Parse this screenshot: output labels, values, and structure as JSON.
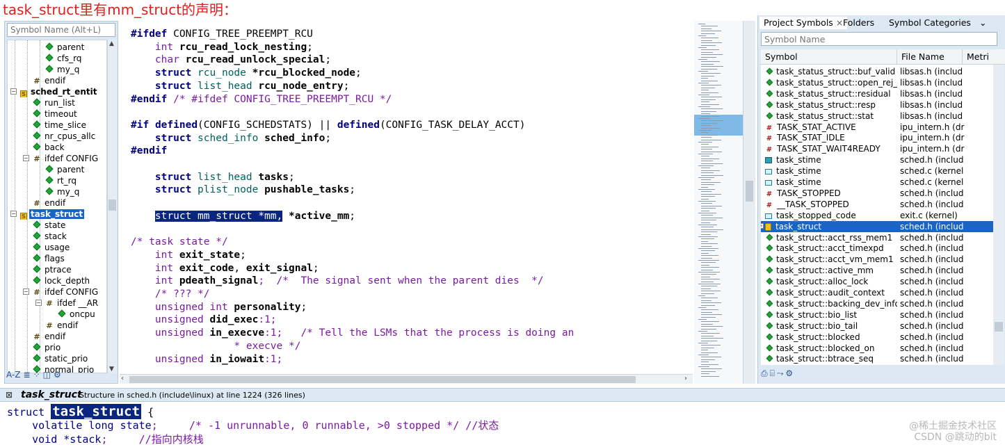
{
  "heading": "task_struct里有mm_struct的声明：",
  "left_panel": {
    "search_placeholder": "Symbol Name (Alt+L)",
    "tools": [
      "A-Z",
      "≣",
      "⁘",
      "◫",
      "⚙"
    ],
    "tree": [
      {
        "label": "parent",
        "icon": "member-icon",
        "indent": 3
      },
      {
        "label": "cfs_rq",
        "icon": "member-icon",
        "indent": 3
      },
      {
        "label": "my_q",
        "icon": "member-icon",
        "indent": 3
      },
      {
        "label": "endif",
        "icon": "preproc-icon",
        "indent": 2
      },
      {
        "label": "sched_rt_entit",
        "icon": "struct-icon",
        "indent": 1,
        "expander": "−",
        "bold": true
      },
      {
        "label": "run_list",
        "icon": "member-icon",
        "indent": 2
      },
      {
        "label": "timeout",
        "icon": "member-icon",
        "indent": 2
      },
      {
        "label": "time_slice",
        "icon": "member-icon",
        "indent": 2
      },
      {
        "label": "nr_cpus_allc",
        "icon": "member-icon",
        "indent": 2
      },
      {
        "label": "back",
        "icon": "member-icon",
        "indent": 2
      },
      {
        "label": "ifdef CONFIG",
        "icon": "preproc-icon",
        "indent": 2,
        "expander": "−"
      },
      {
        "label": "parent",
        "icon": "member-icon",
        "indent": 3
      },
      {
        "label": "rt_rq",
        "icon": "member-icon",
        "indent": 3
      },
      {
        "label": "my_q",
        "icon": "member-icon",
        "indent": 3
      },
      {
        "label": "endif",
        "icon": "preproc-icon",
        "indent": 2
      },
      {
        "label": "task_struct",
        "icon": "struct-icon",
        "indent": 1,
        "expander": "−",
        "bold": true,
        "selected": true
      },
      {
        "label": "state",
        "icon": "member-icon",
        "indent": 2
      },
      {
        "label": "stack",
        "icon": "member-icon",
        "indent": 2
      },
      {
        "label": "usage",
        "icon": "member-icon",
        "indent": 2
      },
      {
        "label": "flags",
        "icon": "member-icon",
        "indent": 2
      },
      {
        "label": "ptrace",
        "icon": "member-icon",
        "indent": 2
      },
      {
        "label": "lock_depth",
        "icon": "member-icon",
        "indent": 2
      },
      {
        "label": "ifdef CONFIG",
        "icon": "preproc-icon",
        "indent": 2,
        "expander": "−"
      },
      {
        "label": "ifdef __AR",
        "icon": "preproc-icon",
        "indent": 3,
        "expander": "−"
      },
      {
        "label": "oncpu",
        "icon": "member-icon",
        "indent": 4
      },
      {
        "label": "endif",
        "icon": "preproc-icon",
        "indent": 3
      },
      {
        "label": "endif",
        "icon": "preproc-icon",
        "indent": 2
      },
      {
        "label": "prio",
        "icon": "member-icon",
        "indent": 2
      },
      {
        "label": "static_prio",
        "icon": "member-icon",
        "indent": 2
      },
      {
        "label": "normal_prio",
        "icon": "member-icon",
        "indent": 2
      }
    ]
  },
  "editor": {
    "lines": [
      [
        {
          "t": "#ifdef",
          "c": "pp"
        },
        {
          "t": " CONFIG_TREE_PREEMPT_RCU",
          "c": ""
        }
      ],
      [
        {
          "t": "    int",
          "c": "kw"
        },
        {
          "t": " ",
          "c": ""
        },
        {
          "t": "rcu_read_lock_nesting",
          "c": "id"
        },
        {
          "t": ";",
          "c": ""
        }
      ],
      [
        {
          "t": "    char",
          "c": "kw"
        },
        {
          "t": " ",
          "c": ""
        },
        {
          "t": "rcu_read_unlock_special",
          "c": "id"
        },
        {
          "t": ";",
          "c": ""
        }
      ],
      [
        {
          "t": "    struct",
          "c": "pp"
        },
        {
          "t": " rcu_node ",
          "c": "ty"
        },
        {
          "t": "*rcu_blocked_node",
          "c": "id"
        },
        {
          "t": ";",
          "c": ""
        }
      ],
      [
        {
          "t": "    struct",
          "c": "pp"
        },
        {
          "t": " list_head ",
          "c": "ty"
        },
        {
          "t": "rcu_node_entry",
          "c": "id"
        },
        {
          "t": ";",
          "c": ""
        }
      ],
      [
        {
          "t": "#endif",
          "c": "pp"
        },
        {
          "t": " /* #ifdef CONFIG_TREE_PREEMPT_RCU */",
          "c": "cm"
        }
      ],
      [],
      [
        {
          "t": "#if",
          "c": "pp"
        },
        {
          "t": " ",
          "c": ""
        },
        {
          "t": "defined",
          "c": "pp"
        },
        {
          "t": "(CONFIG_SCHEDSTATS) || ",
          "c": ""
        },
        {
          "t": "defined",
          "c": "pp"
        },
        {
          "t": "(CONFIG_TASK_DELAY_ACCT)",
          "c": ""
        }
      ],
      [
        {
          "t": "    struct",
          "c": "pp"
        },
        {
          "t": " sched_info ",
          "c": "ty"
        },
        {
          "t": "sched_info",
          "c": "id"
        },
        {
          "t": ";",
          "c": ""
        }
      ],
      [
        {
          "t": "#endif",
          "c": "pp"
        }
      ],
      [],
      [
        {
          "t": "    struct",
          "c": "pp"
        },
        {
          "t": " list_head ",
          "c": "ty"
        },
        {
          "t": "tasks",
          "c": "id"
        },
        {
          "t": ";",
          "c": ""
        }
      ],
      [
        {
          "t": "    struct",
          "c": "pp"
        },
        {
          "t": " plist_node ",
          "c": "ty"
        },
        {
          "t": "pushable_tasks",
          "c": "id"
        },
        {
          "t": ";",
          "c": ""
        }
      ],
      [],
      [
        {
          "t": "    ",
          "c": ""
        },
        {
          "t": "struct mm_struct *mm,",
          "c": "hl"
        },
        {
          "t": " ",
          "c": ""
        },
        {
          "t": "*active_mm",
          "c": "id"
        },
        {
          "t": ";",
          "c": ""
        }
      ],
      [],
      [
        {
          "t": "/* task state */",
          "c": "cm"
        }
      ],
      [
        {
          "t": "    int",
          "c": "kw"
        },
        {
          "t": " ",
          "c": ""
        },
        {
          "t": "exit_state",
          "c": "id"
        },
        {
          "t": ";",
          "c": ""
        }
      ],
      [
        {
          "t": "    int",
          "c": "kw"
        },
        {
          "t": " ",
          "c": ""
        },
        {
          "t": "exit_code",
          "c": "id"
        },
        {
          "t": ", ",
          "c": ""
        },
        {
          "t": "exit_signal",
          "c": "id"
        },
        {
          "t": ";",
          "c": ""
        }
      ],
      [
        {
          "t": "    int",
          "c": "kw"
        },
        {
          "t": " ",
          "c": ""
        },
        {
          "t": "pdeath_signal",
          "c": "id"
        },
        {
          "t": ";  /*  The signal sent when the parent dies  */",
          "c": "cm"
        }
      ],
      [
        {
          "t": "    /* ??? */",
          "c": "cm"
        }
      ],
      [
        {
          "t": "    unsigned int",
          "c": "kw"
        },
        {
          "t": " ",
          "c": ""
        },
        {
          "t": "personality",
          "c": "id"
        },
        {
          "t": ";",
          "c": ""
        }
      ],
      [
        {
          "t": "    unsigned",
          "c": "kw"
        },
        {
          "t": " ",
          "c": ""
        },
        {
          "t": "did_exec",
          "c": "id"
        },
        {
          "t": ":1;",
          "c": "cm"
        }
      ],
      [
        {
          "t": "    unsigned",
          "c": "kw"
        },
        {
          "t": " ",
          "c": ""
        },
        {
          "t": "in_execve",
          "c": "id"
        },
        {
          "t": ":1;   /* Tell the LSMs that the process is doing an",
          "c": "cm"
        }
      ],
      [
        {
          "t": "                 * execve */",
          "c": "cm"
        }
      ],
      [
        {
          "t": "    unsigned",
          "c": "kw"
        },
        {
          "t": " ",
          "c": ""
        },
        {
          "t": "in_iowait",
          "c": "id"
        },
        {
          "t": ":1;",
          "c": "cm"
        }
      ]
    ]
  },
  "symbols_panel": {
    "tabs": [
      "Project Symbols",
      "Folders",
      "Symbol Categories"
    ],
    "close_glyph": "×",
    "more_glyph": "⌄",
    "search_placeholder": "Symbol Name",
    "columns": [
      "Symbol",
      "File Name",
      "Metri"
    ],
    "rows": [
      {
        "symbol": "task_status_struct::buf_valid",
        "file": "libsas.h (includ",
        "icon": "member"
      },
      {
        "symbol": "task_status_struct::open_rej_",
        "file": "libsas.h (includ",
        "icon": "member"
      },
      {
        "symbol": "task_status_struct::residual",
        "file": "libsas.h (includ",
        "icon": "member"
      },
      {
        "symbol": "task_status_struct::resp",
        "file": "libsas.h (includ",
        "icon": "member"
      },
      {
        "symbol": "task_status_struct::stat",
        "file": "libsas.h (includ",
        "icon": "member"
      },
      {
        "symbol": "TASK_STAT_ACTIVE",
        "file": "ipu_intern.h (dr",
        "icon": "macro"
      },
      {
        "symbol": "TASK_STAT_IDLE",
        "file": "ipu_intern.h (dr",
        "icon": "macro"
      },
      {
        "symbol": "TASK_STAT_WAIT4READY",
        "file": "ipu_intern.h (dr",
        "icon": "macro"
      },
      {
        "symbol": "task_stime",
        "file": "sched.h (includ",
        "icon": "func"
      },
      {
        "symbol": "task_stime",
        "file": "sched.c (kernel",
        "icon": "var"
      },
      {
        "symbol": "task_stime",
        "file": "sched.c (kernel",
        "icon": "var"
      },
      {
        "symbol": "TASK_STOPPED",
        "file": "sched.h (includ",
        "icon": "macro"
      },
      {
        "symbol": "__TASK_STOPPED",
        "file": "sched.h (includ",
        "icon": "macro"
      },
      {
        "symbol": "task_stopped_code",
        "file": "exit.c (kernel)",
        "icon": "var"
      },
      {
        "symbol": "task_struct",
        "file": "sched.h (includ",
        "icon": "struct",
        "selected": true
      },
      {
        "symbol": "task_struct::acct_rss_mem1",
        "file": "sched.h (includ",
        "icon": "member"
      },
      {
        "symbol": "task_struct::acct_timexpd",
        "file": "sched.h (includ",
        "icon": "member"
      },
      {
        "symbol": "task_struct::acct_vm_mem1",
        "file": "sched.h (includ",
        "icon": "member"
      },
      {
        "symbol": "task_struct::active_mm",
        "file": "sched.h (includ",
        "icon": "member"
      },
      {
        "symbol": "task_struct::alloc_lock",
        "file": "sched.h (includ",
        "icon": "member"
      },
      {
        "symbol": "task_struct::audit_context",
        "file": "sched.h (includ",
        "icon": "member"
      },
      {
        "symbol": "task_struct::backing_dev_info",
        "file": "sched.h (includ",
        "icon": "member"
      },
      {
        "symbol": "task_struct::bio_list",
        "file": "sched.h (includ",
        "icon": "member"
      },
      {
        "symbol": "task_struct::bio_tail",
        "file": "sched.h (includ",
        "icon": "member"
      },
      {
        "symbol": "task_struct::blocked",
        "file": "sched.h (includ",
        "icon": "member"
      },
      {
        "symbol": "task_struct::blocked_on",
        "file": "sched.h (includ",
        "icon": "member"
      },
      {
        "symbol": "task_struct::btrace_seq",
        "file": "sched.h (includ",
        "icon": "member"
      }
    ],
    "tools": [
      "⎙",
      "⌸",
      "⤳",
      "⚙"
    ]
  },
  "context": {
    "icon": "⊠",
    "symbol": "task_struct",
    "info": "Structure in sched.h (include\\linux) at line 1224 (326 lines)",
    "lines": [
      [
        {
          "t": "struct ",
          "c": "ctx-kw"
        },
        {
          "t": "task_struct",
          "c": "ctx-hl"
        },
        {
          "t": " {",
          "c": ""
        }
      ],
      [
        {
          "t": "    volatile long ",
          "c": "ctx-kw"
        },
        {
          "t": "state",
          "c": "ctx-kw"
        },
        {
          "t": ";     /* -1 unrunnable, 0 runnable, >0 stopped */ //状态",
          "c": "ctx-cm"
        }
      ],
      [
        {
          "t": "    void ",
          "c": "ctx-kw"
        },
        {
          "t": "*stack",
          "c": "ctx-kw"
        },
        {
          "t": ";     //指向内核栈",
          "c": "ctx-cm"
        }
      ]
    ],
    "watermarks": [
      "@稀土掘金技术社区",
      "CSDN @跳动的bit"
    ]
  }
}
